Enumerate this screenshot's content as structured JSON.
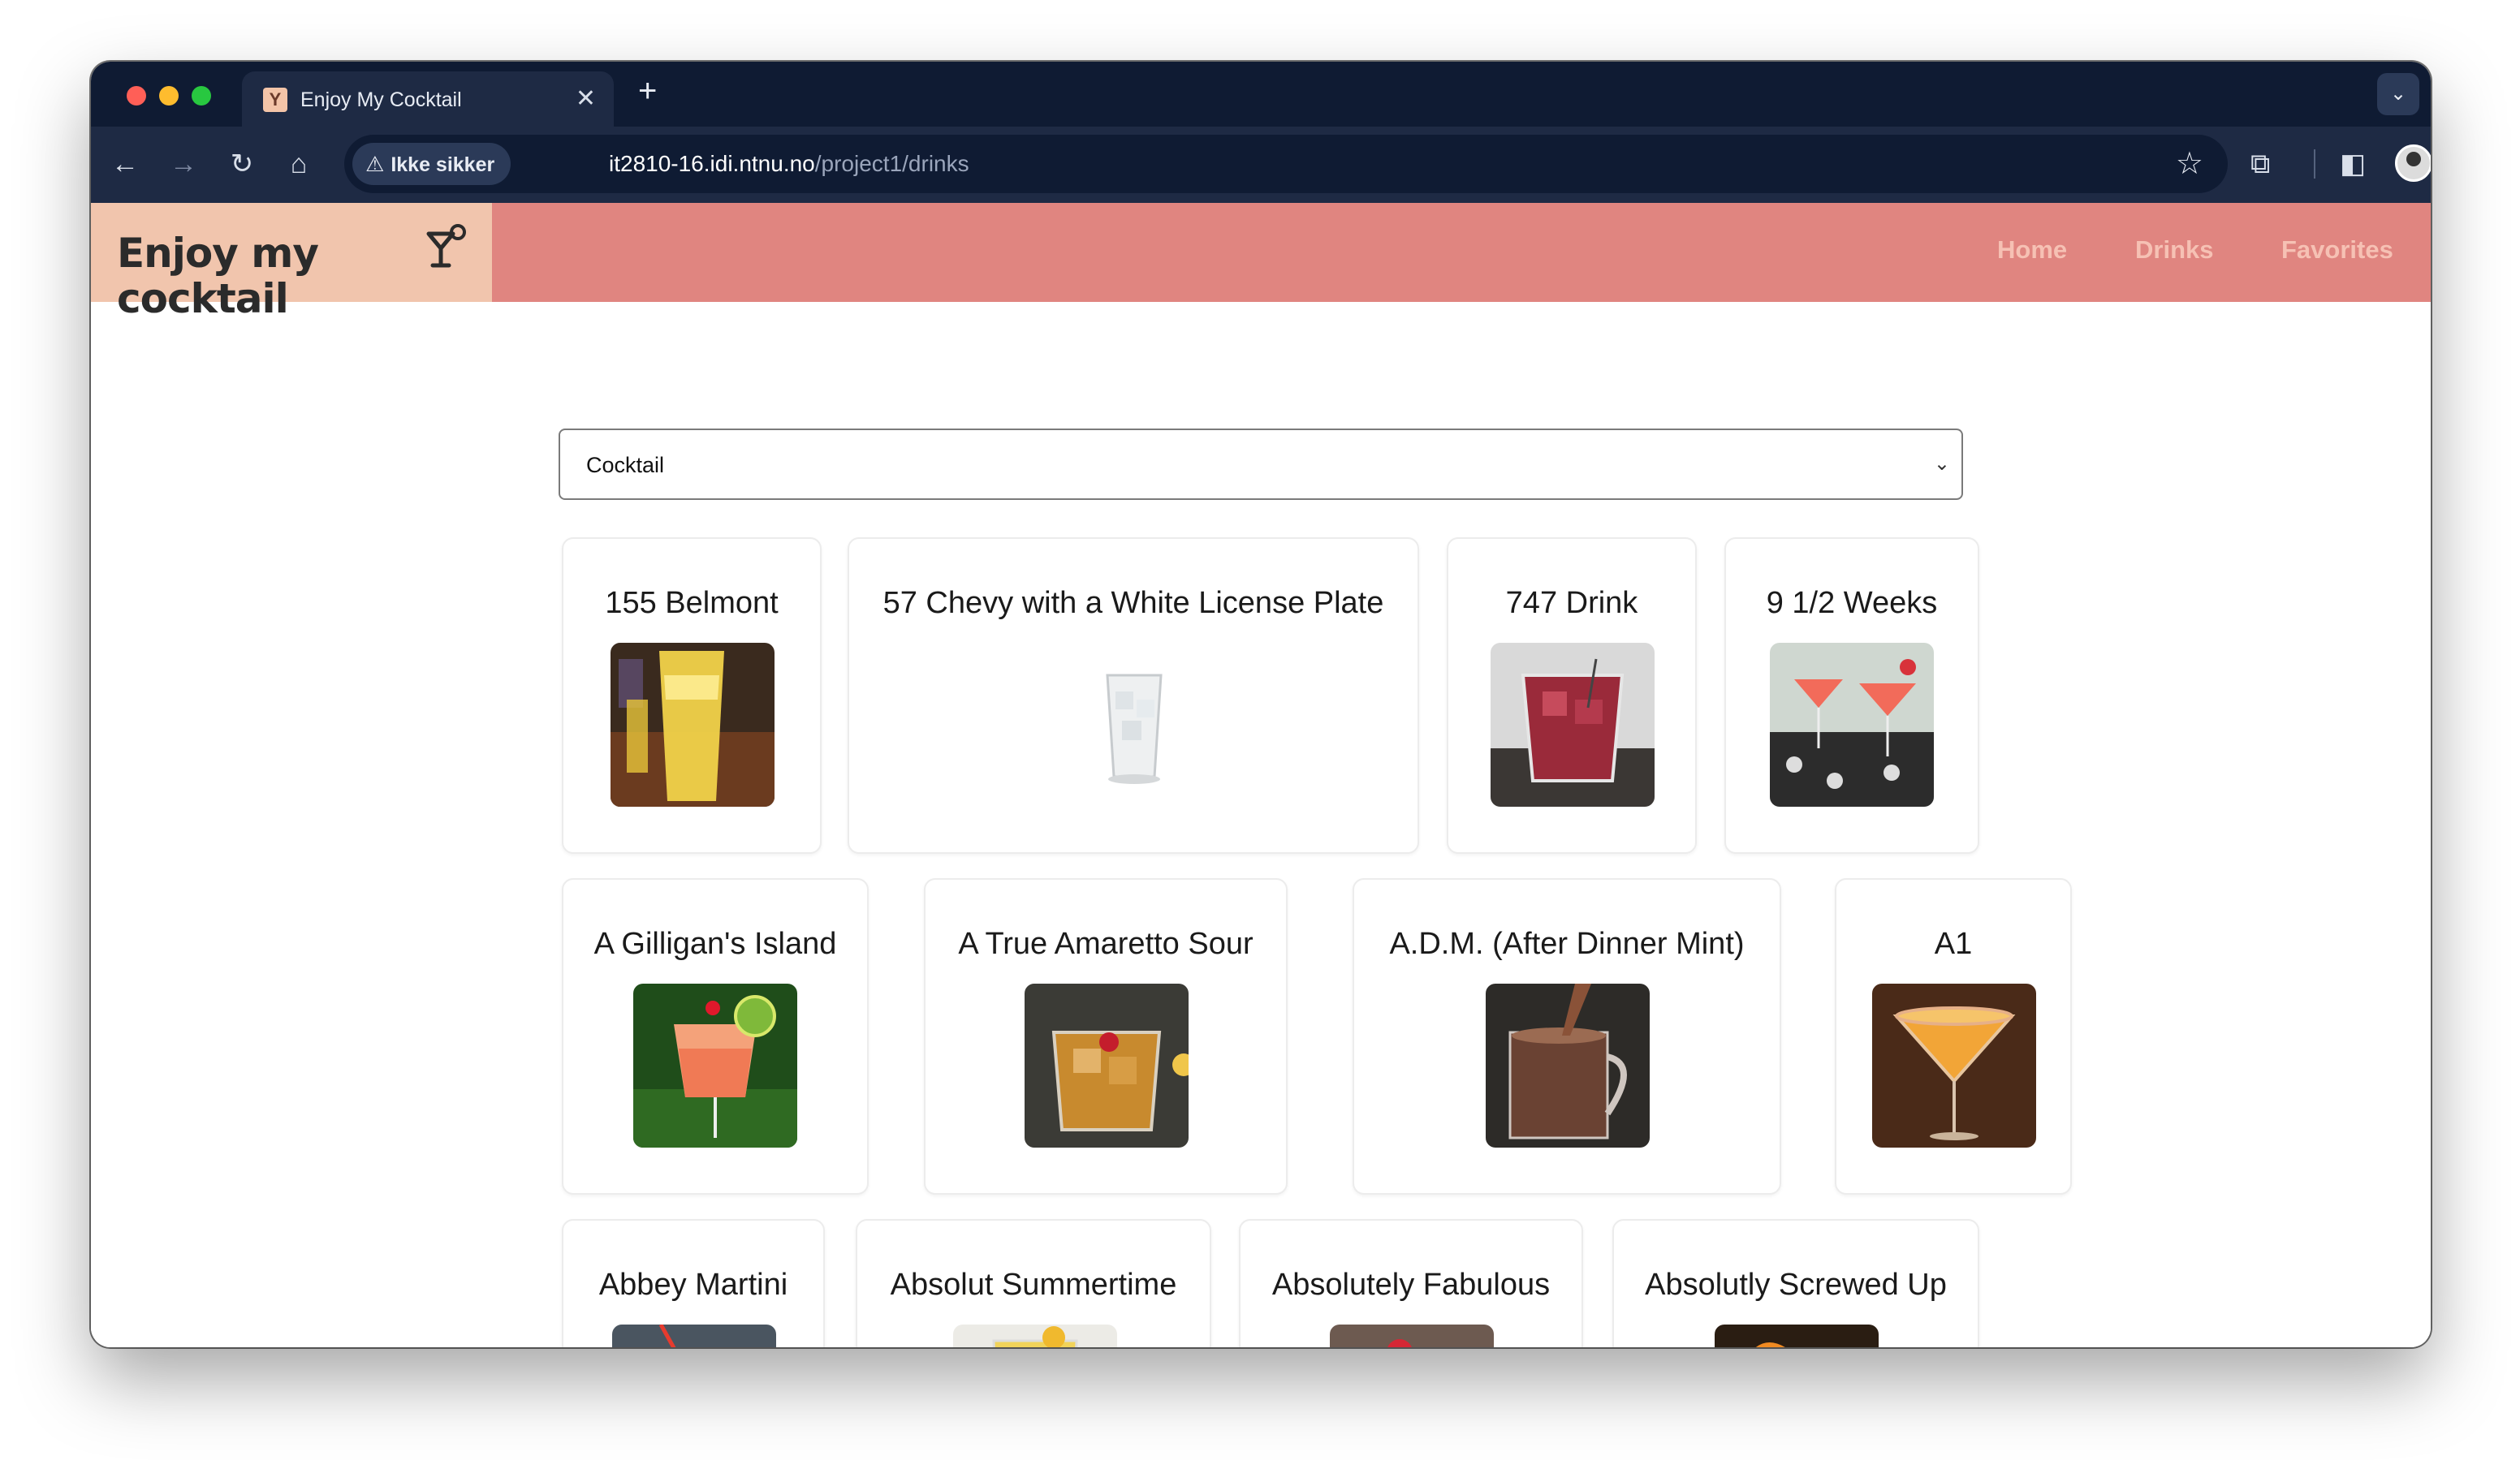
{
  "browser": {
    "tab_title": "Enjoy My Cocktail",
    "new_tab_symbol": "+",
    "security_label": "Ikke sikker",
    "url_host": "it2810-16.idi.ntnu.no",
    "url_path": "/project1/drinks"
  },
  "site": {
    "brand": "Enjoy my cocktail",
    "nav": {
      "home": "Home",
      "drinks": "Drinks",
      "favorites": "Favorites"
    },
    "accent_header": "#e08580",
    "accent_brand": "#f1c5ad"
  },
  "filter": {
    "selected": "Cocktail"
  },
  "drinks": [
    {
      "name": "155 Belmont",
      "image": "yellow-highball-drink"
    },
    {
      "name": "57 Chevy with a White License Plate",
      "image": "clear-ice-glass"
    },
    {
      "name": "747 Drink",
      "image": "red-rocks-drink"
    },
    {
      "name": "9 1/2 Weeks",
      "image": "pink-martini-glasses"
    },
    {
      "name": "A Gilligan's Island",
      "image": "orange-drink-with-kiwi"
    },
    {
      "name": "A True Amaretto Sour",
      "image": "amber-sour-with-cherry"
    },
    {
      "name": "A.D.M. (After Dinner Mint)",
      "image": "chocolate-mug-drink"
    },
    {
      "name": "A1",
      "image": "orange-martini"
    },
    {
      "name": "Abbey Martini",
      "image": "red-martini"
    },
    {
      "name": "Absolut Summertime",
      "image": "lemon-highball"
    },
    {
      "name": "Absolutely Fabulous",
      "image": "pink-drink-strawberry"
    },
    {
      "name": "Absolutly Screwed Up",
      "image": "orange-drink-dark"
    }
  ]
}
